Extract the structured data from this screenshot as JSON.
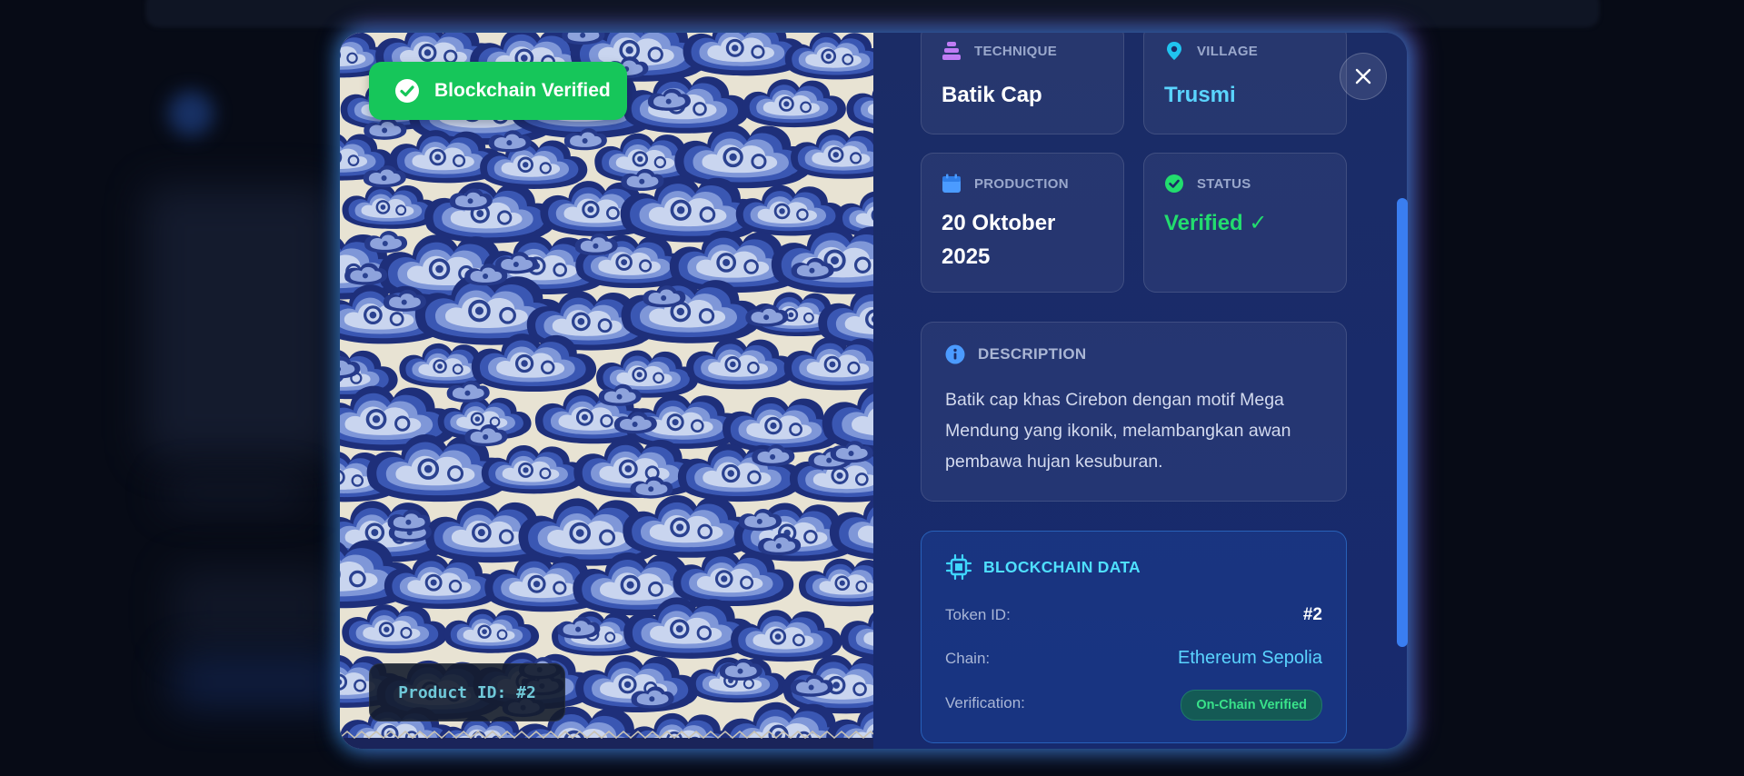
{
  "badge": {
    "label": "Blockchain Verified",
    "icon": "check-circle-icon"
  },
  "product_id": "Product ID: #2",
  "cards": {
    "technique": {
      "label": "TECHNIQUE",
      "value": "Batik Cap",
      "icon": "layers-icon",
      "color": "#c07cf5"
    },
    "village": {
      "label": "VILLAGE",
      "value": "Trusmi",
      "icon": "map-pin-icon",
      "color": "#5ad4ff"
    },
    "production": {
      "label": "PRODUCTION",
      "value": "20 Oktober 2025",
      "icon": "calendar-icon",
      "color": "#5aa3ff"
    },
    "status": {
      "label": "STATUS",
      "value": "Verified ✓",
      "icon": "check-circle-icon",
      "color": "#22dd6e"
    }
  },
  "description": {
    "label": "DESCRIPTION",
    "icon": "info-icon",
    "text": "Batik cap khas Cirebon dengan motif Mega Mendung yang ikonik, melambangkan awan pembawa hujan kesuburan."
  },
  "blockchain": {
    "title": "BLOCKCHAIN DATA",
    "icon": "chip-icon",
    "rows": [
      {
        "label": "Token ID:",
        "value": "#2"
      },
      {
        "label": "Chain:",
        "value": "Ethereum Sepolia"
      },
      {
        "label": "Verification:",
        "value": "On-Chain Verified"
      }
    ]
  },
  "close": {
    "icon": "close-icon"
  },
  "colors": {
    "accent_green": "#16c65a",
    "accent_cyan": "#5ad4ff",
    "modal_bg": "#17286a"
  }
}
